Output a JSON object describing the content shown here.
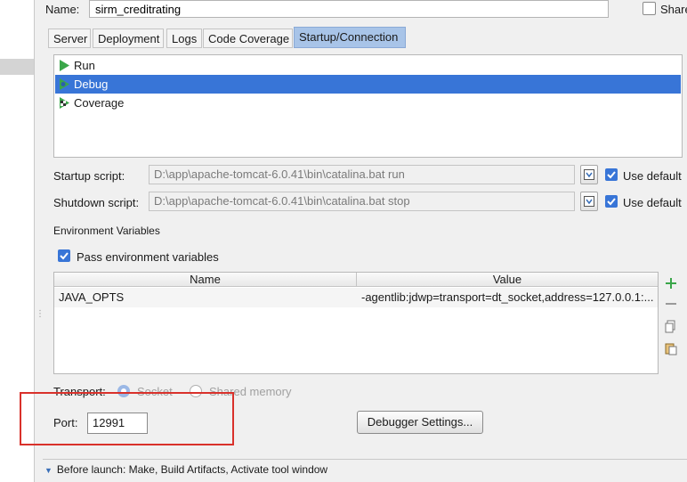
{
  "header": {
    "name_label": "Name:",
    "name_value": "sirm_creditrating",
    "share_label": "Share"
  },
  "tabs": [
    {
      "label": "Server",
      "active": false
    },
    {
      "label": "Deployment",
      "active": false
    },
    {
      "label": "Logs",
      "active": false
    },
    {
      "label": "Code Coverage",
      "active": false
    },
    {
      "label": "Startup/Connection",
      "active": true
    }
  ],
  "modes": [
    {
      "label": "Run",
      "icon": "run-icon",
      "selected": false
    },
    {
      "label": "Debug",
      "icon": "debug-icon",
      "selected": true
    },
    {
      "label": "Coverage",
      "icon": "coverage-icon",
      "selected": false
    }
  ],
  "scripts": {
    "startup_label": "Startup script:",
    "startup_value": "D:\\app\\apache-tomcat-6.0.41\\bin\\catalina.bat run",
    "shutdown_label": "Shutdown script:",
    "shutdown_value": "D:\\app\\apache-tomcat-6.0.41\\bin\\catalina.bat stop",
    "use_default_label": "Use default"
  },
  "env": {
    "title": "Environment Variables",
    "pass_label": "Pass environment variables",
    "columns": [
      "Name",
      "Value"
    ],
    "rows": [
      {
        "name": "JAVA_OPTS",
        "value": "-agentlib:jdwp=transport=dt_socket,address=127.0.0.1:..."
      }
    ]
  },
  "transport": {
    "label": "Transport:",
    "socket_label": "Socket",
    "shared_label": "Shared memory"
  },
  "port": {
    "label": "Port:",
    "value": "12991"
  },
  "debugger_settings_label": "Debugger Settings...",
  "before_launch": "Before launch: Make, Build Artifacts, Activate tool window",
  "colors": {
    "selection": "#3875d7",
    "tab_active": "#a8c4e8",
    "highlight": "#d9312b"
  }
}
